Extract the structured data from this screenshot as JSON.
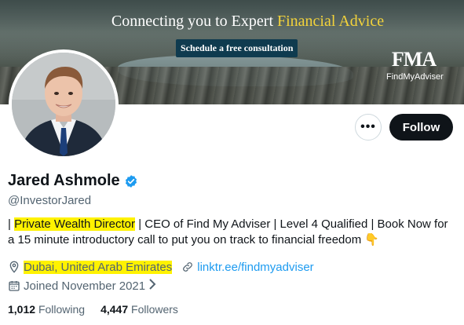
{
  "banner": {
    "title_prefix": "Connecting you to Expert ",
    "title_highlight": "Financial Advice",
    "cta_label": "Schedule a free consultation",
    "logo_mark": "FMA",
    "logo_brand": "FindMyAdviser"
  },
  "actions": {
    "more_label": "•••",
    "follow_label": "Follow"
  },
  "profile": {
    "name": "Jared Ashmole",
    "handle": "@InvestorJared",
    "bio_prefix": "| ",
    "bio_highlight": "Private Wealth Director",
    "bio_rest": " | CEO of Find My Adviser | Level 4 Qualified | Book Now for a 15 minute introductory call to put you on track to financial freedom",
    "bio_emoji": "👇",
    "location": "Dubai, United Arab Emirates",
    "website": "linktr.ee/findmyadviser",
    "joined": "Joined November 2021"
  },
  "stats": {
    "following_count": "1,012",
    "following_label": "Following",
    "followers_count": "4,447",
    "followers_label": "Followers"
  },
  "colors": {
    "accent_blue": "#1d9bf0",
    "highlight_yellow": "#fff200",
    "follow_bg": "#0f1419"
  }
}
